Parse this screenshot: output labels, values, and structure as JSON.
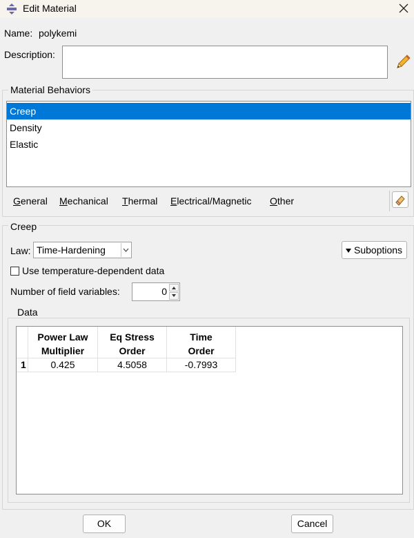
{
  "window": {
    "title": "Edit Material"
  },
  "name": {
    "label": "Name:",
    "value": "polykemi"
  },
  "description": {
    "label": "Description:",
    "value": ""
  },
  "behaviors": {
    "title": "Material Behaviors",
    "items": [
      "Creep",
      "Density",
      "Elastic"
    ],
    "selected": "Creep"
  },
  "menu": {
    "general": {
      "mn": "G",
      "rest": "eneral"
    },
    "mechanical": {
      "mn": "M",
      "rest": "echanical"
    },
    "thermal": {
      "mn": "T",
      "rest": "hermal"
    },
    "electrical": {
      "mn": "E",
      "rest": "lectrical/Magnetic"
    },
    "other": {
      "mn": "O",
      "rest": "ther"
    }
  },
  "creep": {
    "title": "Creep",
    "law_label": "Law:",
    "law_value": "Time-Hardening",
    "suboptions_label": "Suboptions",
    "temp_dependent_label": "Use temperature-dependent data",
    "temp_dependent_checked": false,
    "field_vars_label": "Number of field variables:",
    "field_vars_value": "0"
  },
  "data": {
    "title": "Data",
    "columns": [
      {
        "line1": "Power Law",
        "line2": "Multiplier"
      },
      {
        "line1": "Eq Stress",
        "line2": "Order"
      },
      {
        "line1": "Time",
        "line2": "Order"
      }
    ],
    "rows": [
      {
        "index": "1",
        "values": [
          "0.425",
          "4.5058",
          "-0.7993"
        ]
      }
    ]
  },
  "footer": {
    "ok_label": "OK",
    "cancel_label": "Cancel"
  },
  "colors": {
    "selection": "#0078d7",
    "background": "#f0f0f0"
  },
  "icons": {
    "title": "material-icon",
    "close": "close-icon",
    "edit": "pencil-icon",
    "tool": "eraser-icon"
  }
}
